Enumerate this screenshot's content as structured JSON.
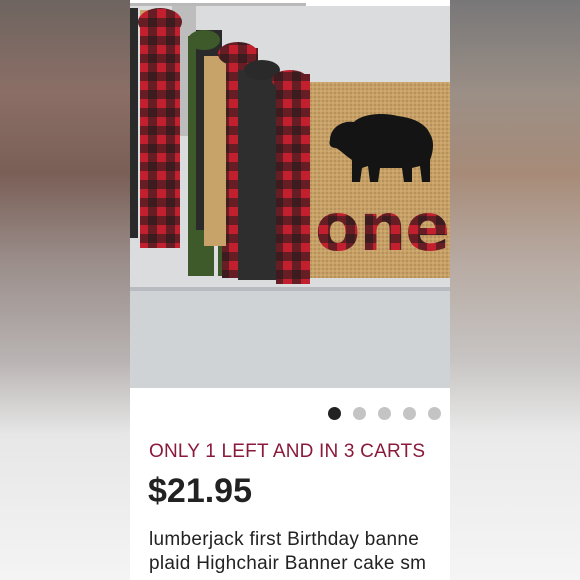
{
  "listing": {
    "stock_notice": "ONLY 1 LEFT AND IN 3 CARTS",
    "price": "$21.95",
    "title_line1": "lumberjack first Birthday banne",
    "title_line2": "plaid Highchair Banner cake sm"
  },
  "image": {
    "banner_text": "one",
    "bear_icon": "bear-silhouette-icon",
    "scroll_progress_fraction": 0.55
  },
  "carousel": {
    "total_images": 5,
    "active_index": 0
  },
  "colors": {
    "stock_notice": "#8a1a3c",
    "price": "#222222",
    "dot_active": "#222222",
    "dot_inactive": "#c4c4c4",
    "plaid_red": "#c2202e",
    "plaid_black": "#1c1c1c",
    "burlap": "#c9a36b"
  }
}
